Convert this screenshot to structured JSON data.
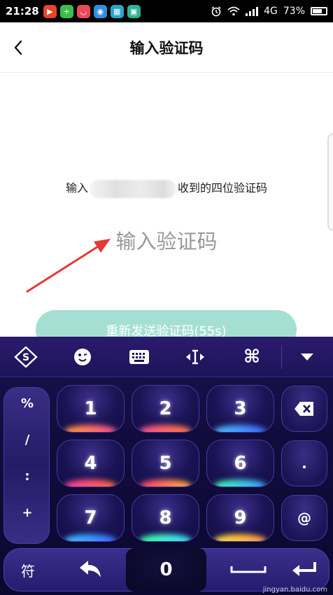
{
  "status_bar": {
    "time": "21:28",
    "network": "4G",
    "battery": "73%",
    "battery_level": 0.73,
    "notification_icons": [
      "video-app-icon",
      "plus-app-icon",
      "shop-app-icon",
      "camera-app-icon",
      "keyboard-app-icon",
      "scan-app-icon"
    ]
  },
  "header": {
    "back_icon": "chevron-left-icon",
    "title": "输入验证码"
  },
  "prompt": {
    "prefix": "输入",
    "suffix": "收到的四位验证码"
  },
  "code_input": {
    "value": "",
    "placeholder": "输入验证码"
  },
  "resend_button": {
    "label": "重新发送验证码(55s)"
  },
  "keyboard": {
    "toolbar_icons": [
      "sogou-logo-icon",
      "emoji-icon",
      "keyboard-icon",
      "cursor-move-icon",
      "command-icon",
      "collapse-icon"
    ],
    "number_keys": [
      "1",
      "2",
      "3",
      "4",
      "5",
      "6",
      "7",
      "8",
      "9"
    ],
    "symbol_keys": [
      "%",
      "/",
      ":",
      "+"
    ],
    "right_keys": [
      ".",
      "@"
    ],
    "bottom_row": {
      "symbols_label": "符",
      "zero": "0"
    },
    "watermark": "jingyan.baidu.com"
  },
  "colors": {
    "accent_button": "#a5dfd4",
    "keyboard_bg": "#120c3d"
  }
}
